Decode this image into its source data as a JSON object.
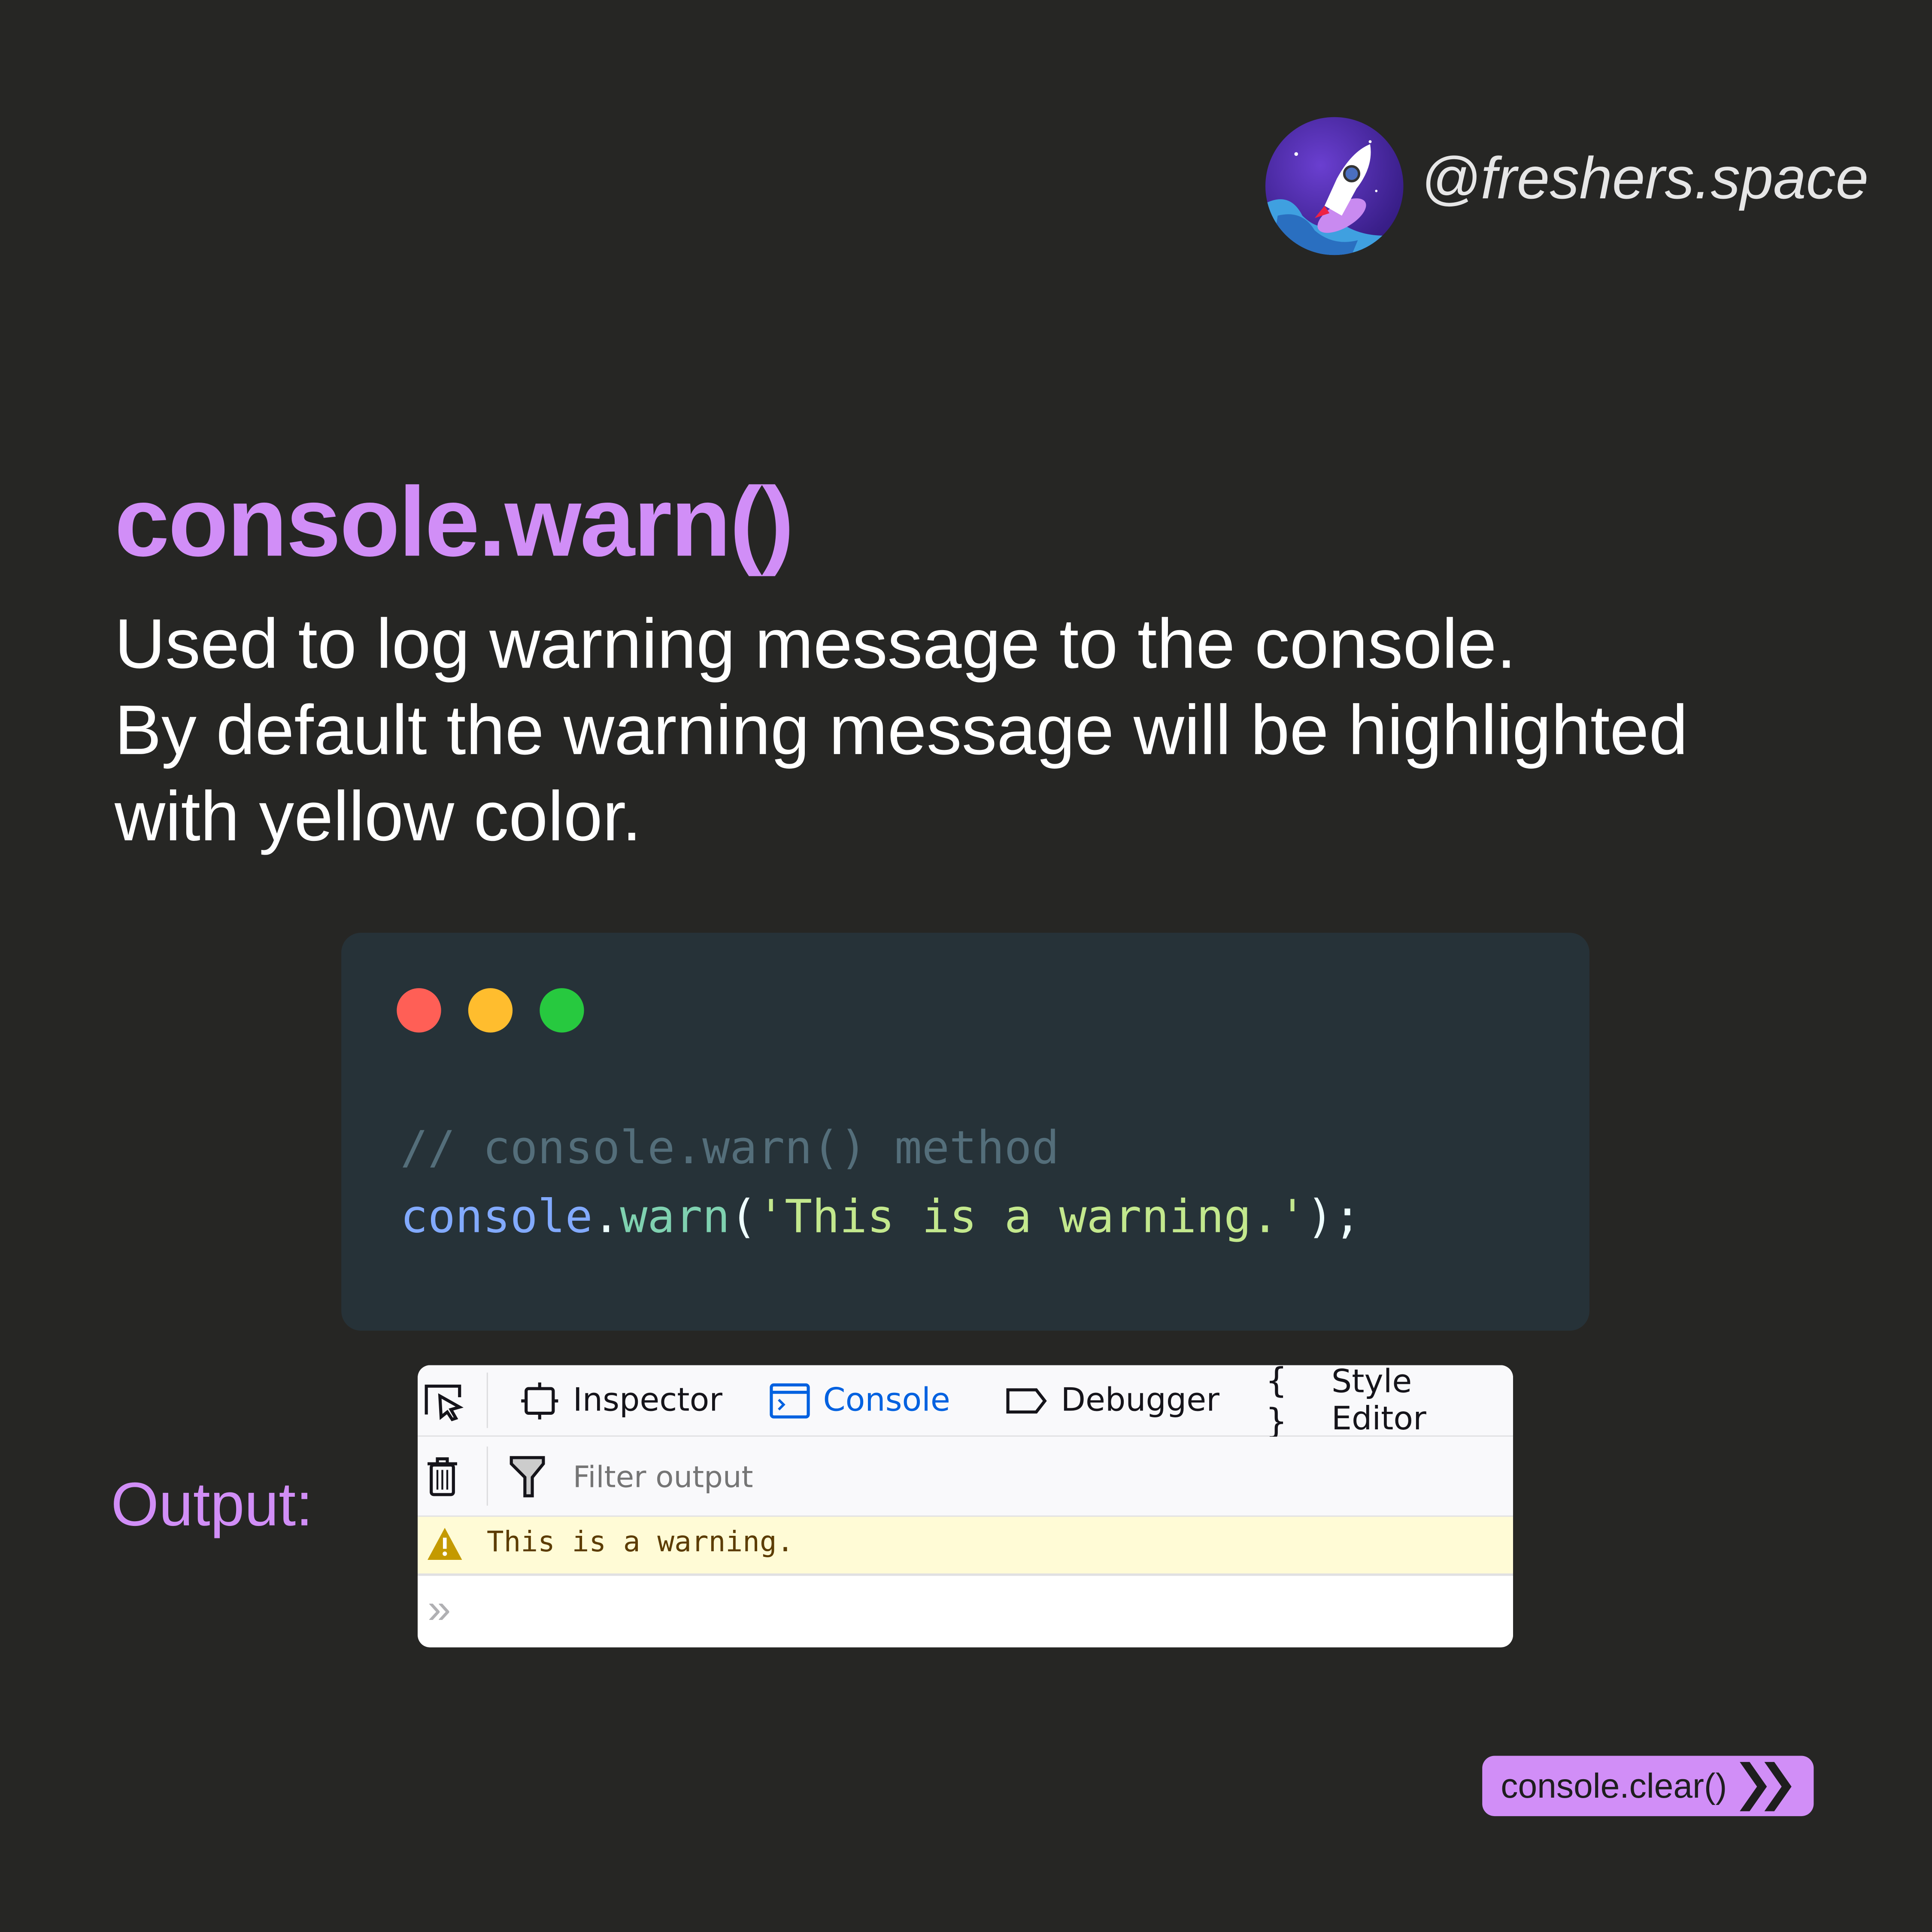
{
  "brand": {
    "handle": "@freshers.space",
    "avatar_icon": "rocket-icon"
  },
  "title": "console.warn()",
  "description": [
    "Used to log warning message to the console.",
    "By default the warning message will be highlighted",
    "with yellow color."
  ],
  "code": {
    "window_dots": [
      "#ff5f56",
      "#ffbd2e",
      "#27c93f"
    ],
    "comment": "// console.warn() method",
    "line2": {
      "object": "console",
      "dot": ".",
      "method": "warn",
      "open": "(",
      "string": "'This is a warning.'",
      "close": ");"
    }
  },
  "output_label": "Output:",
  "devtools": {
    "tabs": [
      {
        "label": "Inspector",
        "icon": "inspector-icon"
      },
      {
        "label": "Console",
        "icon": "console-icon",
        "active": true
      },
      {
        "label": "Debugger",
        "icon": "debugger-icon"
      },
      {
        "label": "Style Editor",
        "icon": "braces-icon"
      }
    ],
    "filter_placeholder": "Filter output",
    "warning_message": "This is a warning.",
    "active_color": "#0061e0",
    "warning_bg": "#fffbd6"
  },
  "next_button": {
    "label": "console.clear()",
    "icon": "double-chevron-right-icon"
  },
  "colors": {
    "accent": "#d18ef7",
    "background": "#262624",
    "code_bg": "#263238"
  }
}
